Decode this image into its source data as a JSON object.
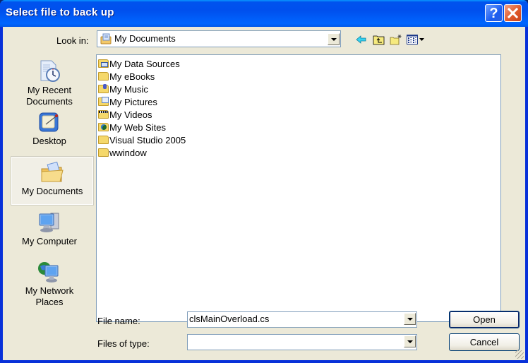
{
  "window": {
    "title": "Select file to back up",
    "help_icon": "help-icon",
    "close_icon": "close-icon",
    "colors": {
      "titlebar": "#0054e3",
      "client": "#ece9d8",
      "help": "#2b63e5",
      "close": "#e05a2b"
    }
  },
  "lookin": {
    "label": "Look in:",
    "value": "My Documents",
    "icon": "my-documents-icon"
  },
  "toolbar": {
    "buttons": [
      {
        "name": "back",
        "icon": "back-arrow-icon"
      },
      {
        "name": "up-one-level",
        "icon": "up-folder-icon"
      },
      {
        "name": "create-new-folder",
        "icon": "new-folder-icon"
      },
      {
        "name": "view-menu",
        "icon": "view-menu-icon"
      }
    ]
  },
  "places": [
    {
      "label": "My Recent Documents",
      "icon": "recent-documents-icon",
      "selected": false
    },
    {
      "label": "Desktop",
      "icon": "desktop-icon",
      "selected": false
    },
    {
      "label": "My Documents",
      "icon": "my-documents-icon",
      "selected": true
    },
    {
      "label": "My Computer",
      "icon": "my-computer-icon",
      "selected": false
    },
    {
      "label": "My Network Places",
      "icon": "network-places-icon",
      "selected": false
    }
  ],
  "files": [
    {
      "name": "My Data Sources",
      "icon": "data-sources-folder-icon"
    },
    {
      "name": "My eBooks",
      "icon": "folder-icon"
    },
    {
      "name": "My Music",
      "icon": "music-folder-icon"
    },
    {
      "name": "My Pictures",
      "icon": "pictures-folder-icon"
    },
    {
      "name": "My Videos",
      "icon": "videos-folder-icon"
    },
    {
      "name": "My Web Sites",
      "icon": "web-sites-folder-icon"
    },
    {
      "name": "Visual Studio 2005",
      "icon": "folder-icon"
    },
    {
      "name": "wwindow",
      "icon": "folder-icon"
    }
  ],
  "filename": {
    "label": "File name:",
    "value": "clsMainOverload.cs"
  },
  "filetype": {
    "label": "Files of type:",
    "value": ""
  },
  "buttons": {
    "open": "Open",
    "cancel": "Cancel"
  }
}
